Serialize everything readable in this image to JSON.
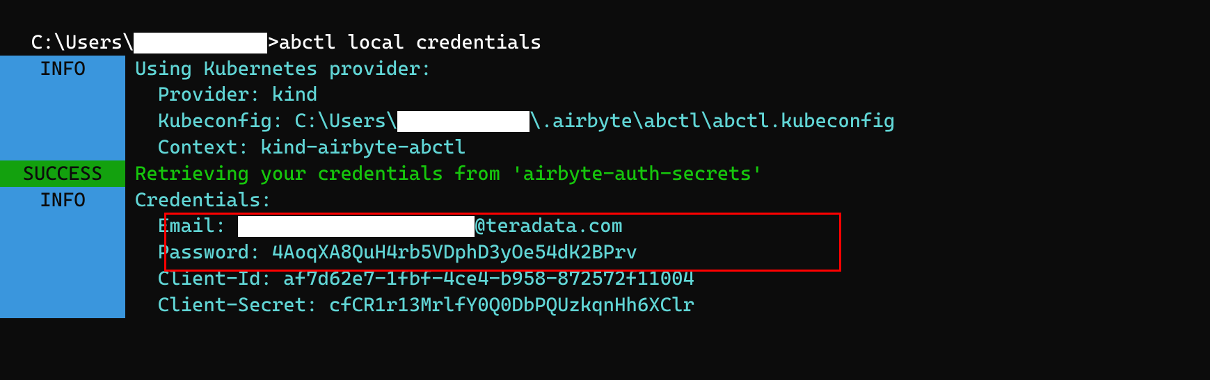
{
  "prompt": {
    "prefix": "C:\\Users\\",
    "suffix": ">",
    "command": "abctl local credentials"
  },
  "tags": {
    "info": "INFO",
    "success": "SUCCESS"
  },
  "lines": {
    "provider_header": "Using Kubernetes provider:",
    "provider_kind": "  Provider: kind",
    "kubeconfig_pre": "  Kubeconfig: C:\\Users\\",
    "kubeconfig_post": "\\.airbyte\\abctl\\abctl.kubeconfig",
    "context": "  Context: kind-airbyte-abctl",
    "retrieving": "Retrieving your credentials from 'airbyte-auth-secrets'",
    "credentials": "Credentials:",
    "email_pre": "  Email: ",
    "email_post": "@teradata.com",
    "password": "  Password: 4AoqXA8QuH4rb5VDphD3yOe54dK2BPrv",
    "client_id": "  Client-Id: af7d62e7-1fbf-4ce4-b958-872572f11004",
    "client_secret": "  Client-Secret: cfCR1r13MrlfY0Q0DbPQUzkqnHh6XClr"
  }
}
